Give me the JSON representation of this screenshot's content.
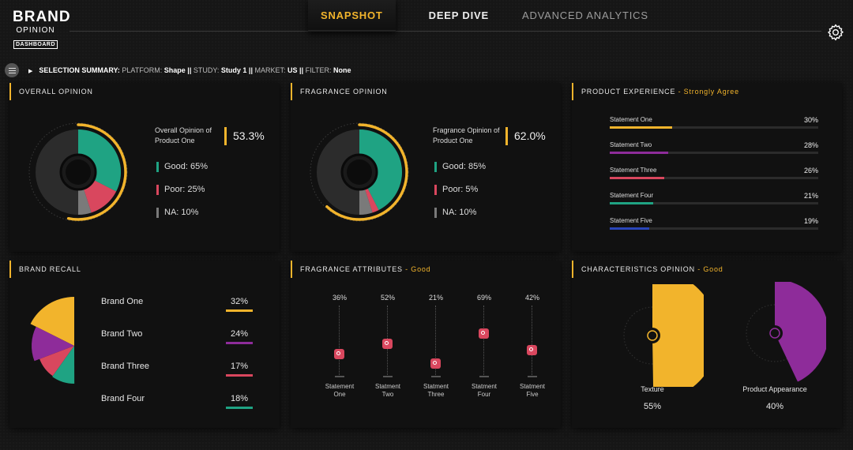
{
  "brand": {
    "line1": "BRAND",
    "line2": "OPINION",
    "line3": "DASHBOARD"
  },
  "nav": {
    "tabs": [
      "SNAPSHOT",
      "DEEP DIVE",
      "ADVANCED ANALYTICS"
    ],
    "active": "SNAPSHOT"
  },
  "icons": {
    "settings": "gear-icon",
    "menu": "hamburger-menu-icon",
    "expand": "caret-right-icon"
  },
  "colors": {
    "accent": "#f2b42c",
    "green": "#1fa383",
    "red": "#d9475e",
    "gray": "#7a7a7a",
    "purple": "#8e2c9a",
    "blue": "#2a46b8",
    "yellow": "#f2b42c"
  },
  "summary": {
    "title": "SELECTION SUMMARY:",
    "platform_label": "PLATFORM:",
    "platform": "Shape",
    "study_label": "STUDY:",
    "study": "Study 1",
    "market_label": "MARKET:",
    "market": "US",
    "filter_label": "FILTER:",
    "filter": "None",
    "sep": "||"
  },
  "overall_opinion": {
    "title": "OVERALL OPINION",
    "label_line1": "Overall Opinion of",
    "label_line2": "Product One",
    "value": "53.3%",
    "gauge_fraction": 0.533,
    "good": "Good: 65%",
    "poor": "Poor: 25%",
    "na": "NA: 10%",
    "good_pct": 65,
    "poor_pct": 25,
    "na_pct": 10
  },
  "fragrance_opinion": {
    "title": "FRAGRANCE OPINION",
    "label_line1": "Fragrance Opinion of",
    "label_line2": "Product One",
    "value": "62.0%",
    "gauge_fraction": 0.62,
    "good": "Good: 85%",
    "poor": "Poor: 5%",
    "na": "NA: 10%",
    "good_pct": 85,
    "poor_pct": 5,
    "na_pct": 10
  },
  "product_experience": {
    "title": "PRODUCT EXPERIENCE",
    "accent": "- Strongly Agree",
    "items": [
      {
        "label": "Statement One",
        "value": "30%",
        "pct": 30,
        "color": "#f2b42c"
      },
      {
        "label": "Statement Two",
        "value": "28%",
        "pct": 28,
        "color": "#8e2c9a"
      },
      {
        "label": "Statement Three",
        "value": "26%",
        "pct": 26,
        "color": "#d9475e"
      },
      {
        "label": "Statement Four",
        "value": "21%",
        "pct": 21,
        "color": "#1fa383"
      },
      {
        "label": "Statement Five",
        "value": "19%",
        "pct": 19,
        "color": "#2a46b8"
      }
    ]
  },
  "brand_recall": {
    "title": "BRAND RECALL",
    "items": [
      {
        "label": "Brand One",
        "value": "32%",
        "pct": 32,
        "color": "#f2b42c"
      },
      {
        "label": "Brand Two",
        "value": "24%",
        "pct": 24,
        "color": "#8e2c9a"
      },
      {
        "label": "Brand Three",
        "value": "17%",
        "pct": 17,
        "color": "#d9475e"
      },
      {
        "label": "Brand Four",
        "value": "18%",
        "pct": 18,
        "color": "#1fa383"
      }
    ]
  },
  "fragrance_attributes": {
    "title": "FRAGRANCE ATTRIBUTES",
    "accent": "- Good",
    "items": [
      {
        "line1": "Statement",
        "line2": "One",
        "value": "36%",
        "pct": 36
      },
      {
        "line1": "Statment",
        "line2": "Two",
        "value": "52%",
        "pct": 52
      },
      {
        "line1": "Statment",
        "line2": "Three",
        "value": "21%",
        "pct": 21
      },
      {
        "line1": "Statment",
        "line2": "Four",
        "value": "69%",
        "pct": 69
      },
      {
        "line1": "Statment",
        "line2": "Five",
        "value": "42%",
        "pct": 42
      }
    ]
  },
  "characteristics_opinion": {
    "title": "CHARACTERISTICS OPINION",
    "accent": "- Good",
    "items": [
      {
        "label": "Texture",
        "value": "55%",
        "pct": 55,
        "color": "#f2b42c"
      },
      {
        "label": "Product Appearance",
        "value": "40%",
        "pct": 40,
        "color": "#8e2c9a"
      }
    ]
  }
}
